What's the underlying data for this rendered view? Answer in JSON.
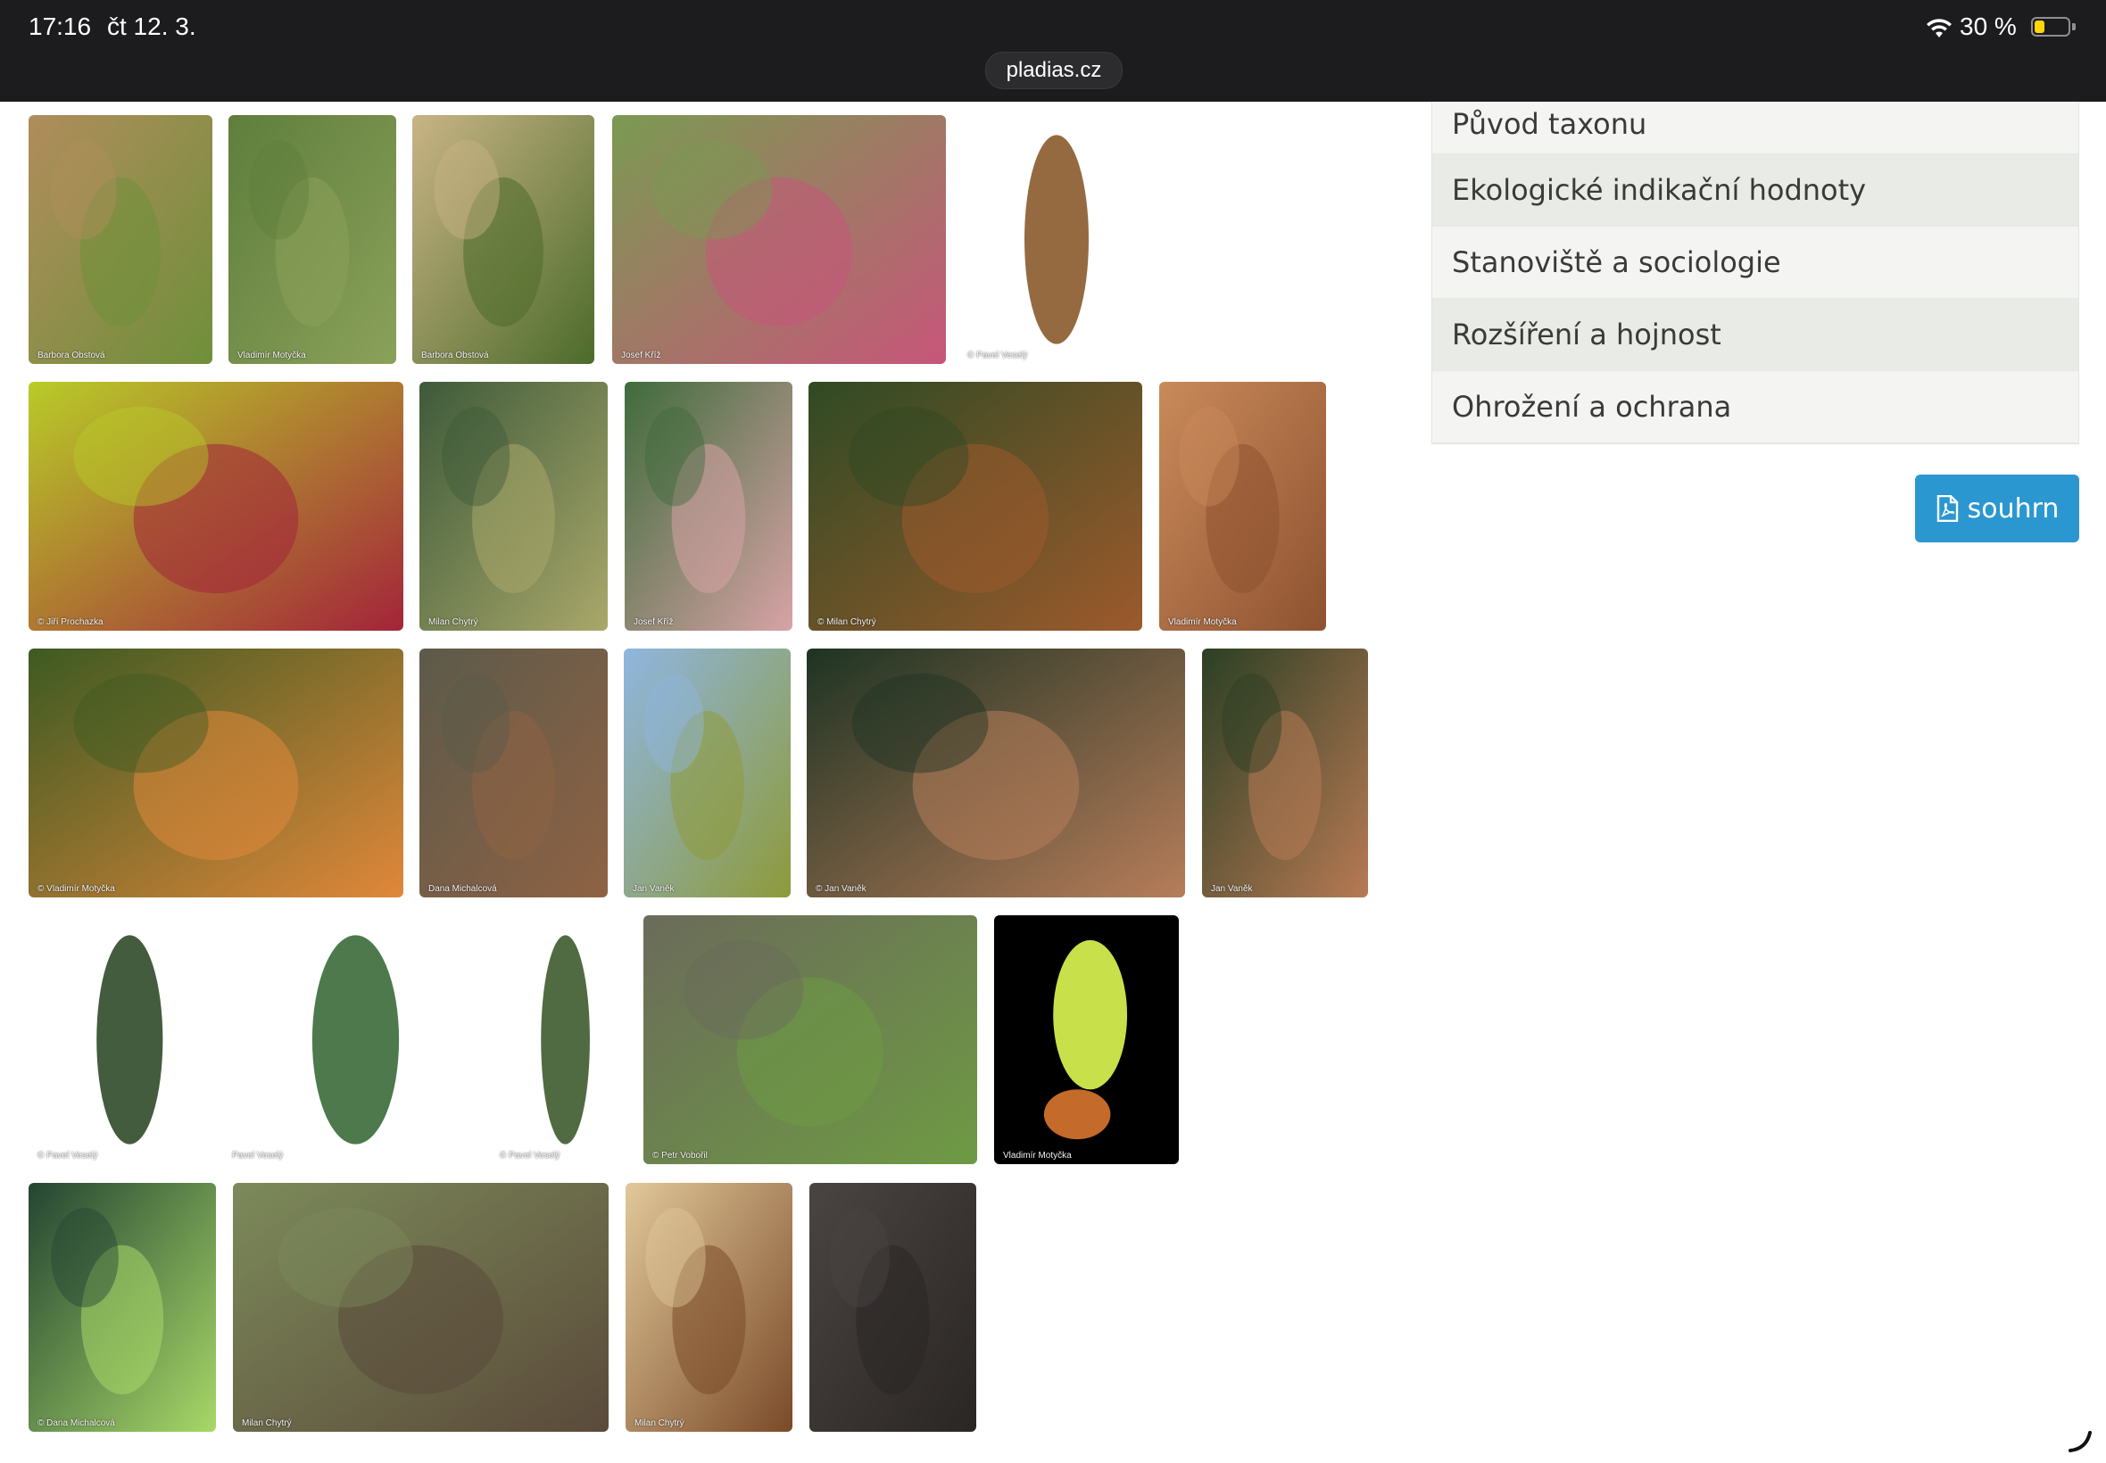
{
  "status_bar": {
    "time": "17:16",
    "date": "čt 12. 3.",
    "battery": "30 %",
    "battery_level": 0.3
  },
  "browser": {
    "url": "pladias.cz"
  },
  "menu": {
    "items": [
      "Původ taxonu",
      "Ekologické indikační hodnoty",
      "Stanoviště a sociologie",
      "Rozšíření a hojnost",
      "Ohrožení a ochrana"
    ]
  },
  "summary_button": {
    "label": "souhrn",
    "icon": "pdf-file-icon"
  },
  "gallery": [
    {
      "credit": "Barbora Obstová",
      "subject": "seedling-photo",
      "colors": [
        "#b08d5c",
        "#6f8f3a"
      ]
    },
    {
      "credit": "Vladimír Motyčka",
      "subject": "young-spruce-photo",
      "colors": [
        "#5f7e3c",
        "#8aa15a"
      ]
    },
    {
      "credit": "Barbora Obstová",
      "subject": "small-spruce-meadow-photo",
      "colors": [
        "#c9b486",
        "#4c6b2a"
      ]
    },
    {
      "credit": "Josef Kříž",
      "subject": "branch-red-cones-photo",
      "colors": [
        "#7a9a52",
        "#c7567a"
      ]
    },
    {
      "credit": "© Pavel Veselý",
      "subject": "cone-with-ruler-photo",
      "colors": [
        "#ffffff",
        "#8a5a2b"
      ]
    },
    {
      "credit": "© Jiří Prochazka",
      "subject": "red-flower-cones-photo",
      "colors": [
        "#b8cc28",
        "#a3243a"
      ]
    },
    {
      "credit": "Milan Chytrý",
      "subject": "green-cones-photo",
      "colors": [
        "#3e5a3a",
        "#a9a86a"
      ]
    },
    {
      "credit": "Josef Kříž",
      "subject": "pink-cone-photo",
      "colors": [
        "#3f6b3c",
        "#d7a3a6"
      ]
    },
    {
      "credit": "© Milan Chytrý",
      "subject": "two-cones-photo",
      "colors": [
        "#2f4a24",
        "#9c5a2c"
      ]
    },
    {
      "credit": "Vladimír Motyčka",
      "subject": "cone-scales-closeup-photo",
      "colors": [
        "#c98a5a",
        "#8e5230"
      ]
    },
    {
      "credit": "© Vladimír Motyčka",
      "subject": "open-cones-photo",
      "colors": [
        "#3d5a22",
        "#e0883a"
      ]
    },
    {
      "credit": "Dana Michalcová",
      "subject": "fallen-cone-photo",
      "colors": [
        "#5c5a4a",
        "#8e6244"
      ]
    },
    {
      "credit": "Jan Vaněk",
      "subject": "treetop-cones-photo",
      "colors": [
        "#8fb6e0",
        "#8e9a3a"
      ]
    },
    {
      "credit": "© Jan Vaněk",
      "subject": "hanging-cones-photo",
      "colors": [
        "#1e3323",
        "#b67d5a"
      ]
    },
    {
      "credit": "Jan Vaněk",
      "subject": "cones-cluster-photo",
      "colors": [
        "#2b3f24",
        "#b77a54"
      ]
    },
    {
      "credit": "© Pavel Veselý",
      "subject": "twig-herbarium-photo",
      "colors": [
        "#ffffff",
        "#2f4a28"
      ]
    },
    {
      "credit": "Pavel Veselý",
      "subject": "needles-closeup-photo",
      "colors": [
        "#ffffff",
        "#3a6a3a"
      ]
    },
    {
      "credit": "© Pavel Veselý",
      "subject": "shoot-herbarium-photo",
      "colors": [
        "#ffffff",
        "#3d5b2e"
      ]
    },
    {
      "credit": "© Petr Vobořil",
      "subject": "branch-buds-photo",
      "colors": [
        "#6b6b5a",
        "#6e9a44"
      ]
    },
    {
      "credit": "Vladimír Motyčka",
      "subject": "new-shoot-black-photo",
      "colors": [
        "#000000",
        "#c8e04a"
      ]
    },
    {
      "credit": "© Dana Michalcová",
      "subject": "fresh-shoots-photo",
      "colors": [
        "#244432",
        "#a8d868"
      ]
    },
    {
      "credit": "Milan Chytrý",
      "subject": "forest-roots-photo",
      "colors": [
        "#7c8a5a",
        "#5a4a3a"
      ]
    },
    {
      "credit": "Milan Chytrý",
      "subject": "trunk-cross-section-photo",
      "colors": [
        "#e1c89a",
        "#7a4a28"
      ]
    },
    {
      "credit": "",
      "subject": "bark-photo",
      "colors": [
        "#4a4442",
        "#2a2624"
      ]
    }
  ]
}
